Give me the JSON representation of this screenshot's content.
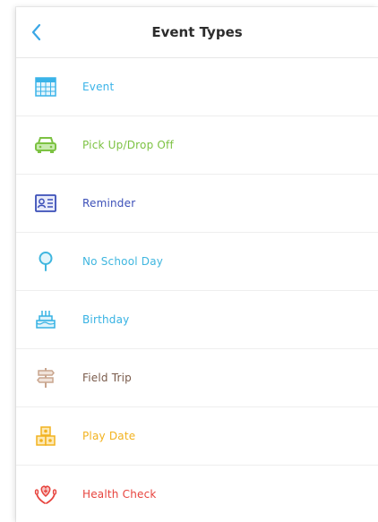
{
  "header": {
    "title": "Event Types",
    "back_icon": "chevron-left-icon",
    "accent": "#3aa7e6"
  },
  "items": [
    {
      "label": "Event",
      "icon": "calendar-grid-icon",
      "color": "#3ab3e8"
    },
    {
      "label": "Pick Up/Drop Off",
      "icon": "car-icon",
      "color": "#7cc242"
    },
    {
      "label": "Reminder",
      "icon": "id-card-icon",
      "color": "#3b4fb8"
    },
    {
      "label": "No School Day",
      "icon": "location-pin-icon",
      "color": "#3fb6df"
    },
    {
      "label": "Birthday",
      "icon": "birthday-cake-icon",
      "color": "#36b2e3"
    },
    {
      "label": "Field Trip",
      "icon": "signpost-icon",
      "color": "#7a5b4b"
    },
    {
      "label": "Play Date",
      "icon": "building-blocks-icon",
      "color": "#f2b21e"
    },
    {
      "label": "Health Check",
      "icon": "heart-hands-icon",
      "color": "#e7433d"
    }
  ]
}
